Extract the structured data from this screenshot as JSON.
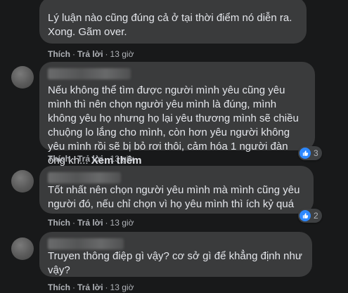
{
  "comments": [
    {
      "text": "Lý luận nào cũng đúng cả ở tại thời điểm nó diễn ra. Xong. Gãm over.",
      "see_more": "",
      "like_label": "Thích",
      "reply_label": "Trả lời",
      "time": "13 giờ",
      "reactions": null
    },
    {
      "text": "Nếu không thể tìm được người mình yêu cũng yêu mình thì nên chọn người yêu mình là đúng, mình không yêu họ nhưng họ lại yêu thương mình sẽ chiều chuộng lo lắng cho mình, còn hơn yêu người không yêu mình rồi sẽ bị bỏ rơi thôi, cảm hóa 1 người đàn ông kh... ",
      "see_more": "Xem thêm",
      "like_label": "Thích",
      "reply_label": "Trả lời",
      "time": "13 giờ",
      "reactions": "3"
    },
    {
      "text": "Tốt nhất nên chọn người yêu mình mà mình cũng yêu người đó, nếu chỉ chọn vì họ yêu mình thì ích kỷ quá",
      "see_more": "",
      "like_label": "Thích",
      "reply_label": "Trả lời",
      "time": "13 giờ",
      "reactions": "2"
    },
    {
      "text": "Truyen thông điệp gì vậy? cơ sở gì để khẳng định như vậy?",
      "see_more": "",
      "like_label": "Thích",
      "reply_label": "Trả lời",
      "time": "13 giờ",
      "reactions": null
    }
  ],
  "separator": "·",
  "colors": {
    "background": "#18191a",
    "bubble": "#3a3b3c",
    "text": "#e4e6eb",
    "secondary_text": "#b0b3b8",
    "like_blue": "#2d88ff"
  },
  "icons": {
    "reaction": "like-icon",
    "options": "more-options-icon"
  }
}
